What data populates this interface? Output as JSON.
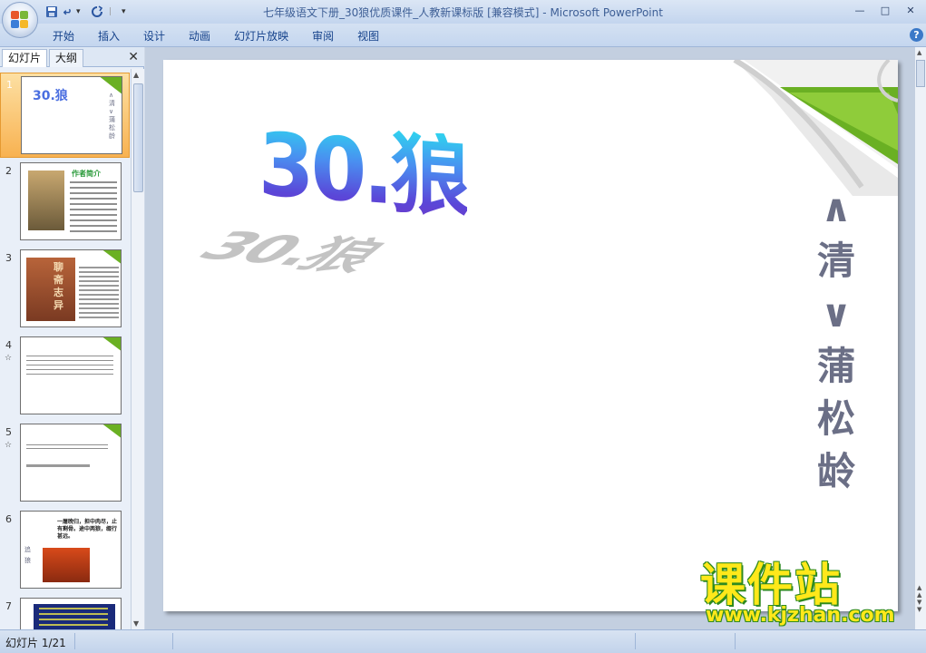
{
  "app": {
    "window_title": "七年级语文下册_30狼优质课件_人教新课标版 [兼容模式] - Microsoft PowerPoint",
    "window_controls": [
      "—",
      "□",
      "✕"
    ]
  },
  "ribbon": {
    "tabs": [
      "开始",
      "插入",
      "设计",
      "动画",
      "幻灯片放映",
      "审阅",
      "视图"
    ],
    "help": "?"
  },
  "left_pane": {
    "tabs": [
      "幻灯片",
      "大纲"
    ],
    "close": "✕",
    "thumbnails": [
      {
        "number": "1",
        "selected": true,
        "title": "30.狼",
        "side": "∧清∨蒲松龄"
      },
      {
        "number": "2",
        "selected": false,
        "heading": "作者简介"
      },
      {
        "number": "3",
        "selected": false,
        "cover": "聊斋志异"
      },
      {
        "number": "4",
        "selected": false,
        "star": "☆"
      },
      {
        "number": "5",
        "selected": false,
        "star": "☆"
      },
      {
        "number": "6",
        "selected": false,
        "text": "一屠晚归，担中肉尽，止有剩骨。途中两狼，缀行甚远。",
        "side": "追狼"
      },
      {
        "number": "7",
        "selected": false
      }
    ]
  },
  "slide": {
    "title": "30.狼",
    "author_lines": [
      "∧",
      "清",
      "∨",
      "蒲",
      "松",
      "龄"
    ]
  },
  "watermark": {
    "name": "课件站",
    "url": "www.kjzhan.com"
  },
  "statusbar": {
    "slide_indicator": "幻灯片 1/21"
  },
  "colors": {
    "accent_green": "#6ab023",
    "title_blue": "#4a6ee0",
    "author_gray": "#6b6f86",
    "watermark_yellow": "#ffe81a"
  }
}
